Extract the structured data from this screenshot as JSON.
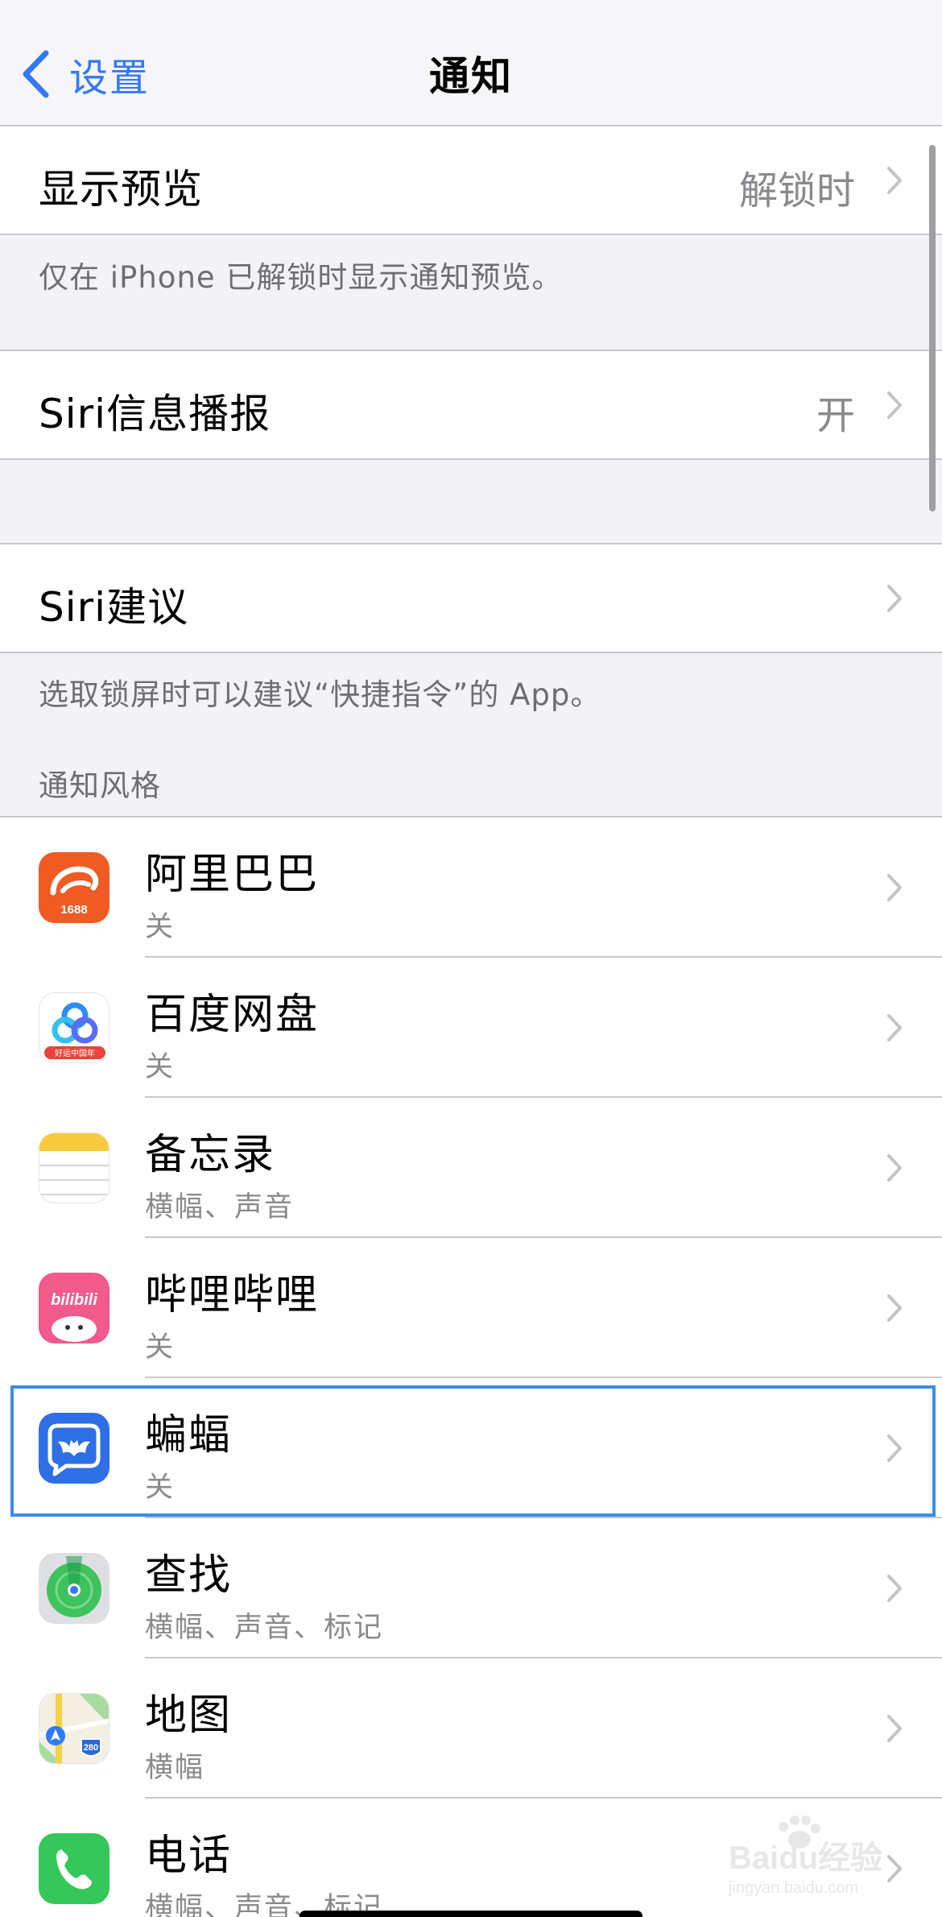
{
  "nav": {
    "back_label": "设置",
    "title": "通知"
  },
  "settings": {
    "show_preview": {
      "label": "显示预览",
      "value": "解锁时"
    },
    "preview_footer": "仅在 iPhone 已解锁时显示通知预览。",
    "siri_announce": {
      "label": "Siri信息播报",
      "value": "开"
    },
    "siri_suggestions": {
      "label": "Siri建议"
    },
    "suggestions_footer": "选取锁屏时可以建议“快捷指令”的 App。"
  },
  "notification_style": {
    "header": "通知风格",
    "apps": [
      {
        "name": "阿里巴巴",
        "status": "关",
        "icon": "alibaba-1688-icon"
      },
      {
        "name": "百度网盘",
        "status": "关",
        "icon": "baidu-netdisk-icon"
      },
      {
        "name": "备忘录",
        "status": "横幅、声音",
        "icon": "notes-icon"
      },
      {
        "name": "哔哩哔哩",
        "status": "关",
        "icon": "bilibili-icon"
      },
      {
        "name": "蝙蝠",
        "status": "关",
        "icon": "bat-messenger-icon"
      },
      {
        "name": "查找",
        "status": "横幅、声音、标记",
        "icon": "find-my-icon"
      },
      {
        "name": "地图",
        "status": "横幅",
        "icon": "maps-icon"
      },
      {
        "name": "电话",
        "status": "横幅、声音、标记",
        "icon": "phone-icon"
      }
    ]
  },
  "icon_text": {
    "alibaba_badge": "1688",
    "maps_shield": "280",
    "bilibili_logo": "bilibili",
    "baidu_badge": "好运中国年"
  },
  "watermark": {
    "brand": "Baidu经验",
    "url": "jingyan.baidu.com"
  },
  "colors": {
    "accent": "#3478f6",
    "highlight_border": "#3b8ee0",
    "background": "#f2f2f7",
    "secondary_text": "#8a8a8e"
  }
}
